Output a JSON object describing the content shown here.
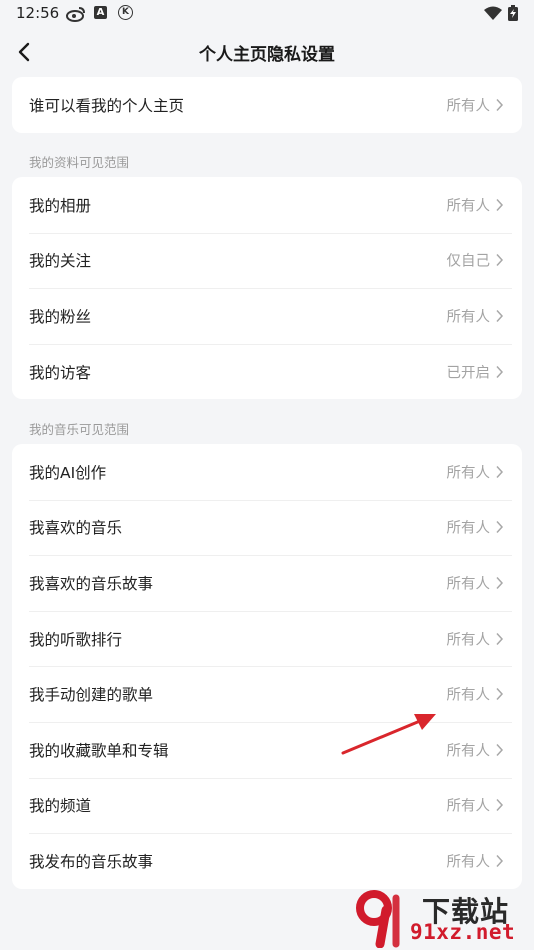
{
  "status_bar": {
    "time": "12:56",
    "icons": [
      "weibo-icon",
      "a-app-icon",
      "k-app-icon",
      "wifi-icon",
      "battery-charging-icon"
    ],
    "a_icon_text": "A",
    "k_icon_text": "K"
  },
  "header": {
    "title": "个人主页隐私设置"
  },
  "main_card": {
    "items": [
      {
        "label": "谁可以看我的个人主页",
        "value": "所有人"
      }
    ]
  },
  "profile_section": {
    "title": "我的资料可见范围",
    "items": [
      {
        "label": "我的相册",
        "value": "所有人"
      },
      {
        "label": "我的关注",
        "value": "仅自己"
      },
      {
        "label": "我的粉丝",
        "value": "所有人"
      },
      {
        "label": "我的访客",
        "value": "已开启"
      }
    ]
  },
  "music_section": {
    "title": "我的音乐可见范围",
    "items": [
      {
        "label": "我的AI创作",
        "value": "所有人"
      },
      {
        "label": "我喜欢的音乐",
        "value": "所有人"
      },
      {
        "label": "我喜欢的音乐故事",
        "value": "所有人"
      },
      {
        "label": "我的听歌排行",
        "value": "所有人"
      },
      {
        "label": "我手动创建的歌单",
        "value": "所有人"
      },
      {
        "label": "我的收藏歌单和专辑",
        "value": "所有人"
      },
      {
        "label": "我的频道",
        "value": "所有人"
      },
      {
        "label": "我发布的音乐故事",
        "value": "所有人"
      }
    ]
  },
  "watermark": {
    "line1": "下载站",
    "line2": "91xz.net"
  },
  "colors": {
    "background": "#f4f5f7",
    "card": "#ffffff",
    "value_text": "#a3a3a3",
    "annotation_arrow": "#d9262c"
  }
}
